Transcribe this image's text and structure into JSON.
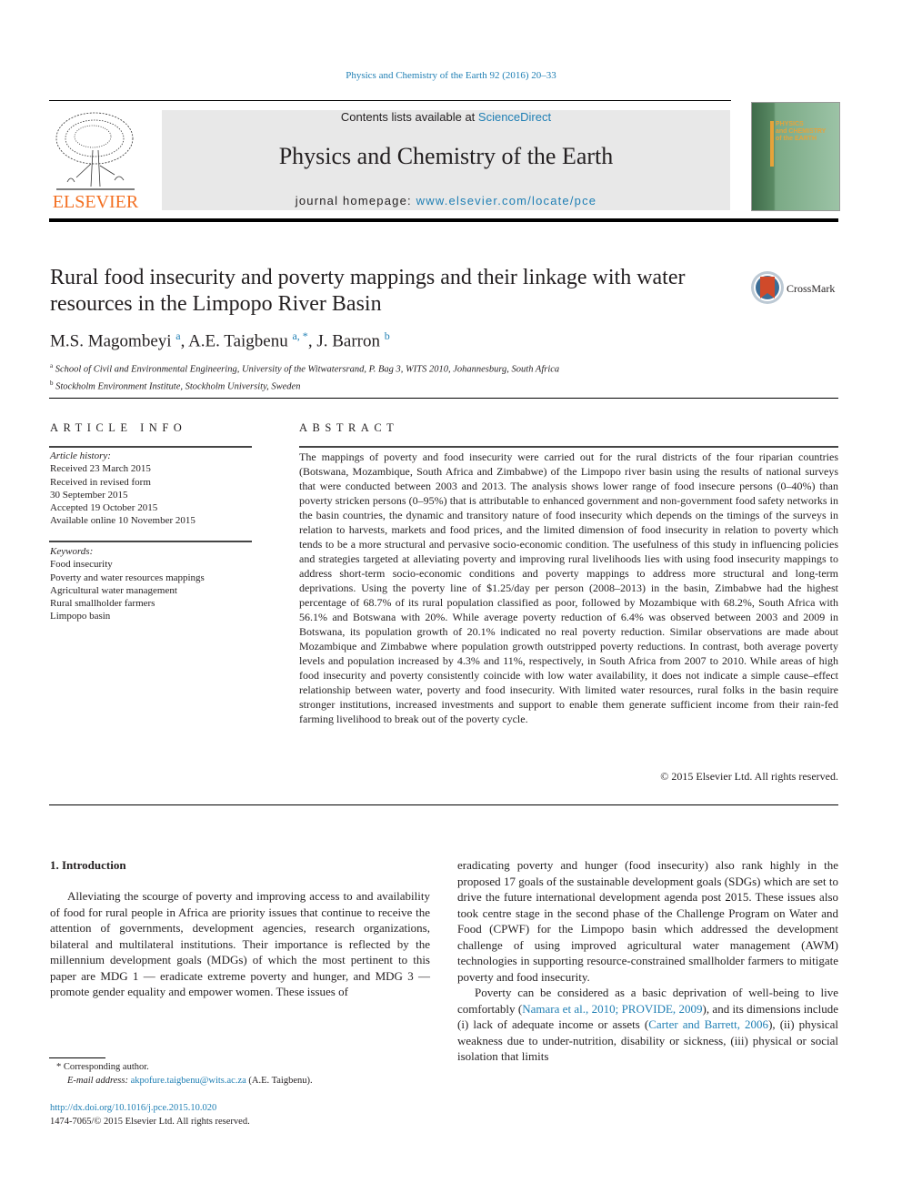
{
  "journal_ref": "Physics and Chemistry of the Earth 92 (2016) 20–33",
  "header": {
    "publisher_logo_text": "ELSEVIER",
    "contents_prefix": "Contents lists available at ",
    "contents_link": "ScienceDirect",
    "journal_title": "Physics and Chemistry of the Earth",
    "homepage_prefix": "journal homepage: ",
    "homepage_link": "www.elsevier.com/locate/pce",
    "cover_text": [
      "PHYSICS",
      "and CHEMISTRY",
      "of the EARTH"
    ]
  },
  "article": {
    "title": "Rural food insecurity and poverty mappings and their linkage with water resources in the Limpopo River Basin",
    "crossmark_label": "CrossMark",
    "authors": [
      {
        "name": "M.S. Magombeyi",
        "sup": "a"
      },
      {
        "name": "A.E. Taigbenu",
        "sup": "a, *"
      },
      {
        "name": "J. Barron",
        "sup": "b"
      }
    ],
    "affiliations": [
      {
        "sup": "a",
        "text": "School of Civil and Environmental Engineering, University of the Witwatersrand, P. Bag 3, WITS 2010, Johannesburg, South Africa"
      },
      {
        "sup": "b",
        "text": "Stockholm Environment Institute, Stockholm University, Sweden"
      }
    ]
  },
  "article_info": {
    "heading": "ARTICLE INFO",
    "history_label": "Article history:",
    "history": [
      "Received 23 March 2015",
      "Received in revised form",
      "30 September 2015",
      "Accepted 19 October 2015",
      "Available online 10 November 2015"
    ],
    "keywords_label": "Keywords:",
    "keywords": [
      "Food insecurity",
      "Poverty and water resources mappings",
      "Agricultural water management",
      "Rural smallholder farmers",
      "Limpopo basin"
    ]
  },
  "abstract": {
    "heading": "ABSTRACT",
    "text": "The mappings of poverty and food insecurity were carried out for the rural districts of the four riparian countries (Botswana, Mozambique, South Africa and Zimbabwe) of the Limpopo river basin using the results of national surveys that were conducted between 2003 and 2013. The analysis shows lower range of food insecure persons (0–40%) than poverty stricken persons (0–95%) that is attributable to enhanced government and non-government food safety networks in the basin countries, the dynamic and tran­sitory nature of food insecurity which depends on the timings of the surveys in relation to harvests, markets and food prices, and the limited dimension of food insecurity in relation to poverty which tends to be a more structural and pervasive socio-economic condition. The usefulness of this study in influ­encing policies and strategies targeted at alleviating poverty and improving rural livelihoods lies with using food insecurity mappings to address short-term socio-economic conditions and poverty mappings to address more structural and long-term deprivations. Using the poverty line of $1.25/day per person (2008–2013) in the basin, Zimbabwe had the highest percentage of 68.7% of its rural population clas­sified as poor, followed by Mozambique with 68.2%, South Africa with 56.1% and Botswana with 20%. While average poverty reduction of 6.4% was observed between 2003 and 2009 in Botswana, its pop­ulation growth of 20.1% indicated no real poverty reduction. Similar observations are made about Mozambique and Zimbabwe where population growth outstripped poverty reductions. In contrast, both average poverty levels and population increased by 4.3% and 11%, respectively, in South Africa from 2007 to 2010. While areas of high food insecurity and poverty consistently coincide with low water availability, it does not indicate a simple cause–effect relationship between water, poverty and food insecurity. With limited water resources, rural folks in the basin require stronger institutions, increased investments and support to enable them generate sufficient income from their rain-fed farming livelihood to break out of the poverty cycle.",
    "copyright": "© 2015 Elsevier Ltd. All rights reserved."
  },
  "introduction": {
    "heading": "1.  Introduction",
    "col1_para1": "Alleviating the scourge of poverty and improving access to and availability of food for rural people in Africa are priority issues that continue to receive the attention of governments, development agencies, research organizations, bilateral and multilateral in­stitutions. Their importance is reflected by the millennium devel­opment goals (MDGs) of which the most pertinent to this paper are MDG 1 — eradicate extreme poverty and hunger, and MDG 3 — promote gender equality and empower women. These issues of",
    "col2_para1": "eradicating poverty and hunger (food insecurity) also rank highly in the proposed 17 goals of the sustainable development goals (SDGs) which are set to drive the future international development agenda post 2015. These issues also took centre stage in the second phase of the Challenge Program on Water and Food (CPWF) for the Limpopo basin which addressed the development challenge of using improved agricultural water management (AWM) technologies in supporting resource-constrained smallholder farmers to mitigate poverty and food insecurity.",
    "col2_para2_a": "Poverty can be considered as a basic deprivation of well-being to live comfortably (",
    "col2_para2_cite1": "Namara et al., 2010; PROVIDE, 2009",
    "col2_para2_b": "), and its di­mensions include (i) lack of adequate income or assets (",
    "col2_para2_cite2": "Carter and Barrett, 2006",
    "col2_para2_c": "), (ii) physical weakness due to under-nutrition, disability or sickness, (iii) physical or social isolation that limits"
  },
  "footnotes": {
    "corresponding_marker": "*",
    "corresponding_text": "Corresponding author.",
    "email_label": "E-mail address:",
    "email": "akpofure.taigbenu@wits.ac.za",
    "email_owner": "(A.E. Taigbenu).",
    "doi": "http://dx.doi.org/10.1016/j.pce.2015.10.020",
    "issn_copyright": "1474-7065/© 2015 Elsevier Ltd. All rights reserved."
  }
}
